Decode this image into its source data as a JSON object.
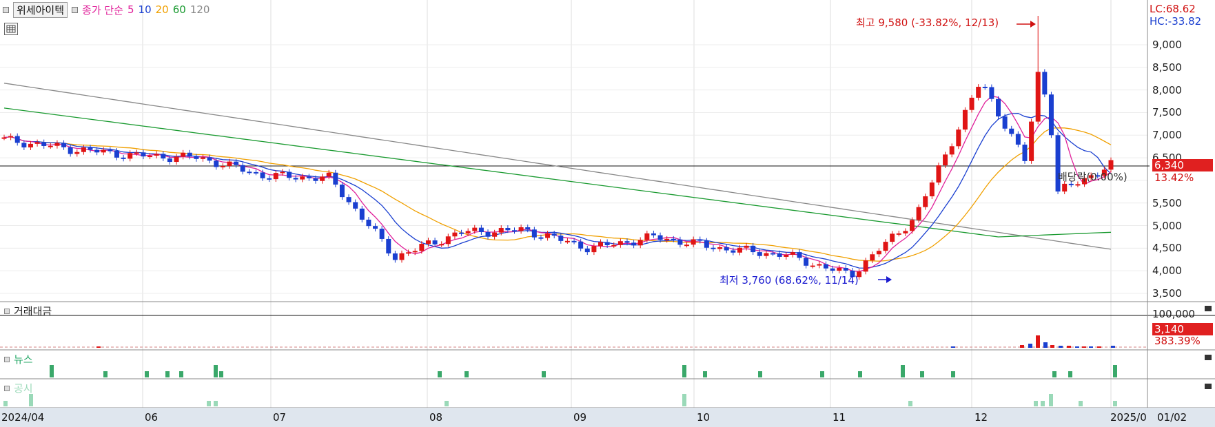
{
  "header": {
    "stock_name": "위세아이텍",
    "ma_label": "종가 단순",
    "ma_periods": [
      "5",
      "10",
      "20",
      "60",
      "120"
    ],
    "ma_colors": [
      "#e0209a",
      "#1a3fd0",
      "#f0a000",
      "#1a9a30",
      "#888888"
    ]
  },
  "annotations": {
    "high": "최고 9,580 (-33.82%, 12/13)",
    "low": "최저 3,760 (68.62%, 11/14)",
    "ex_dividend": "배당락(0.00%)"
  },
  "right_panel": {
    "lc": "LC:68.62",
    "hc": "HC:-33.82",
    "price_box": "6,340",
    "price_change": "13.42%",
    "volume_box": "3,140",
    "volume_change": "383.39%"
  },
  "price_axis": [
    "9,000",
    "8,500",
    "8,000",
    "7,500",
    "7,000",
    "6,500",
    "5,500",
    "5,000",
    "4,500",
    "4,000",
    "3,500"
  ],
  "volume_axis": [
    "100,000"
  ],
  "panels": {
    "volume_title": "거래대금",
    "news_title": "뉴스",
    "disclosure_title": "공시"
  },
  "x_axis": [
    "2024/04",
    "06",
    "07",
    "08",
    "09",
    "10",
    "11",
    "12",
    "2025/0",
    "01/02"
  ],
  "chart_data": {
    "type": "candlestick",
    "title": "위세아이텍",
    "period": "2024/04 - 2025/01/02",
    "ylim": [
      3400,
      10000
    ],
    "current_price": 6340,
    "high": {
      "value": 9580,
      "date": "12/13"
    },
    "low": {
      "value": 3760,
      "date": "11/14"
    },
    "close_series": [
      {
        "date": "2024/04",
        "value": 6900
      },
      {
        "date": "05",
        "value": 6700
      },
      {
        "date": "06",
        "value": 6550
      },
      {
        "date": "06-mid",
        "value": 6500
      },
      {
        "date": "07",
        "value": 6100
      },
      {
        "date": "07-mid",
        "value": 6050
      },
      {
        "date": "08",
        "value": 4300
      },
      {
        "date": "08-mid",
        "value": 4850
      },
      {
        "date": "09",
        "value": 4900
      },
      {
        "date": "09-mid",
        "value": 4500
      },
      {
        "date": "10",
        "value": 4750
      },
      {
        "date": "10-mid",
        "value": 4500
      },
      {
        "date": "11",
        "value": 4350
      },
      {
        "date": "11-mid",
        "value": 3900
      },
      {
        "date": "12",
        "value": 5200
      },
      {
        "date": "12-mid",
        "value": 8200
      },
      {
        "date": "12-late",
        "value": 5600
      },
      {
        "date": "2025/01/02",
        "value": 6340
      }
    ]
  }
}
